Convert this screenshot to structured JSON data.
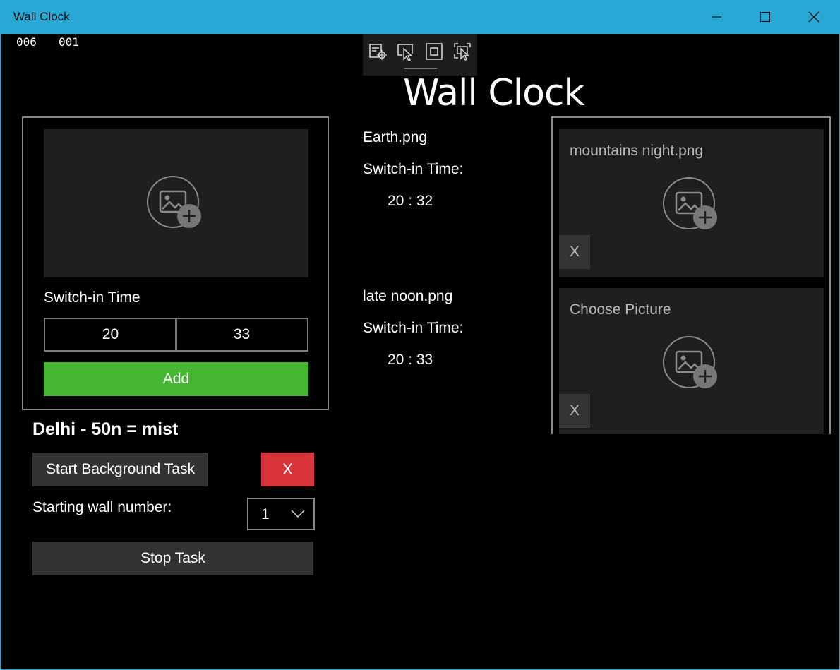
{
  "window": {
    "title": "Wall Clock",
    "minimize_icon": "minimize-icon",
    "maximize_icon": "maximize-icon",
    "close_icon": "close-icon"
  },
  "frame_counters": [
    "006",
    "001"
  ],
  "devtools": {
    "tools": [
      "select-element-icon",
      "display-layout-adorners-icon",
      "track-focused-element-icon",
      "show-selected-element-icon"
    ]
  },
  "app_title": "Wall Clock",
  "editor": {
    "image_icon": "add-image-icon",
    "switch_in_label": "Switch-in Time",
    "hour": "20",
    "minute": "33",
    "add_label": "Add"
  },
  "weather": "Delhi - 50n = mist",
  "background_task": {
    "start_label": "Start Background Task",
    "remove_label": "X",
    "starting_wall_label": "Starting wall number:",
    "starting_wall_value": "1",
    "stop_label": "Stop Task"
  },
  "schedule": [
    {
      "file": "Earth.png",
      "switch_label": "Switch-in Time:",
      "time": "20 : 32"
    },
    {
      "file": "late noon.png",
      "switch_label": "Switch-in Time:",
      "time": "20 : 33"
    }
  ],
  "pictures": [
    {
      "name": "mountains night.png",
      "remove_label": "X"
    },
    {
      "name": "Choose Picture",
      "remove_label": "X"
    }
  ],
  "colors": {
    "titlebar": "#2aa8d5",
    "add_button": "#46b632",
    "remove_button": "#d9343a",
    "tile": "#1f1f1f"
  }
}
